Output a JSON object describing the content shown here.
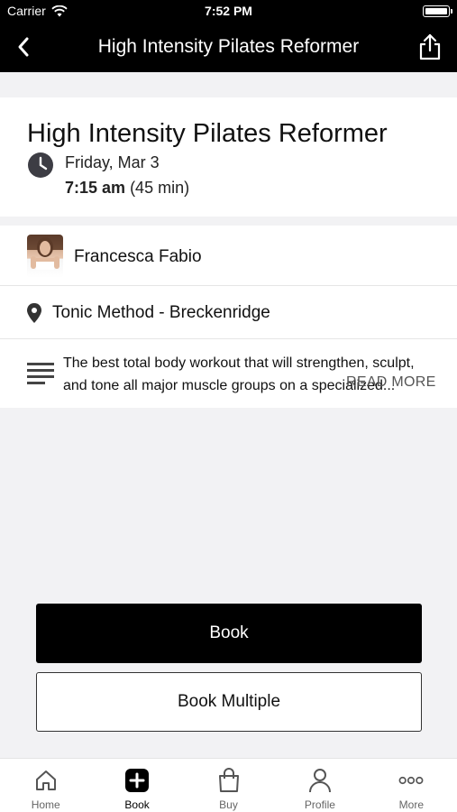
{
  "status_bar": {
    "carrier": "Carrier",
    "time": "7:52 PM"
  },
  "nav": {
    "title": "High Intensity Pilates Reformer",
    "back_icon": "chevron-left-icon",
    "share_icon": "share-icon"
  },
  "class_info": {
    "title": "High Intensity Pilates Reformer",
    "date": "Friday, Mar 3",
    "time": "7:15 am",
    "duration": "(45 min)"
  },
  "instructor": {
    "name": "Francesca Fabio"
  },
  "location": {
    "name": "Tonic Method - Breckenridge"
  },
  "description": {
    "line1": "The best total body workout that will strengthen, sculpt,",
    "line2": "and tone all major muscle groups on a specialized...",
    "read_more": "READ MORE"
  },
  "actions": {
    "book": "Book",
    "book_multiple": "Book Multiple"
  },
  "tabs": [
    {
      "label": "Home",
      "icon": "home-icon"
    },
    {
      "label": "Book",
      "icon": "plus-square-icon"
    },
    {
      "label": "Buy",
      "icon": "shopping-bag-icon"
    },
    {
      "label": "Profile",
      "icon": "person-icon"
    },
    {
      "label": "More",
      "icon": "more-dots-icon"
    }
  ],
  "colors": {
    "nav_bg": "#000000",
    "primary_button": "#000000",
    "page_bg": "#f2f2f4"
  }
}
